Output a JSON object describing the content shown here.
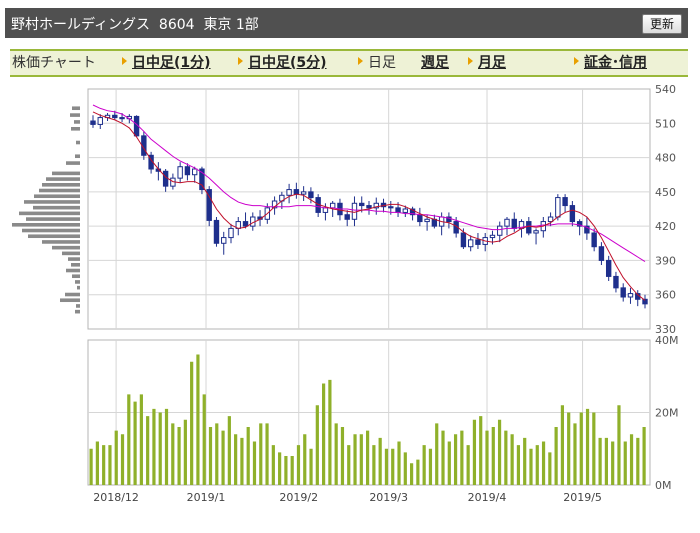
{
  "header": {
    "title": "野村ホールディングス  8604  東京 1部",
    "refresh_label": "更新"
  },
  "tabs": [
    {
      "label": "株価チャート",
      "link": false,
      "arrow": false
    },
    {
      "label": "日中足(1分)",
      "link": true,
      "arrow": true
    },
    {
      "label": "日中足(5分)",
      "link": true,
      "arrow": true
    },
    {
      "label": "日足",
      "link": false,
      "arrow": true
    },
    {
      "label": "週足",
      "link": true,
      "arrow": false
    },
    {
      "label": "月足",
      "link": true,
      "arrow": true
    },
    {
      "label": "証金･信用",
      "link": true,
      "arrow": true
    }
  ],
  "colors": {
    "candle": "#1e2f8c",
    "ma_short": "#c0102a",
    "ma_long": "#cc00cc",
    "volume": "#8fb02a",
    "profile": "#8a8a8a",
    "grid": "#d6d6d6",
    "border": "#b4b4b4"
  },
  "chart_data": [
    {
      "type": "candlestick",
      "yticks": [
        540,
        510,
        480,
        450,
        420,
        390,
        360,
        330
      ],
      "ylim": [
        330,
        540
      ],
      "xticks": [
        "2018/12",
        "2019/1",
        "2019/2",
        "2019/3",
        "2019/4",
        "2019/5"
      ],
      "grid": true,
      "candles": [
        [
          512,
          517,
          506,
          509
        ],
        [
          509,
          518,
          505,
          515
        ],
        [
          515,
          519,
          512,
          517
        ],
        [
          517,
          521,
          513,
          515
        ],
        [
          515,
          519,
          511,
          514
        ],
        [
          514,
          518,
          510,
          516
        ],
        [
          516,
          517,
          498,
          499
        ],
        [
          499,
          503,
          478,
          482
        ],
        [
          482,
          485,
          466,
          470
        ],
        [
          470,
          476,
          460,
          468
        ],
        [
          468,
          470,
          450,
          455
        ],
        [
          455,
          466,
          452,
          462
        ],
        [
          462,
          476,
          458,
          472
        ],
        [
          472,
          475,
          460,
          465
        ],
        [
          465,
          472,
          458,
          470
        ],
        [
          470,
          472,
          448,
          452
        ],
        [
          452,
          455,
          420,
          425
        ],
        [
          425,
          428,
          402,
          405
        ],
        [
          405,
          415,
          395,
          410
        ],
        [
          410,
          422,
          405,
          418
        ],
        [
          418,
          428,
          412,
          424
        ],
        [
          424,
          432,
          418,
          420
        ],
        [
          420,
          432,
          416,
          428
        ],
        [
          428,
          434,
          420,
          426
        ],
        [
          426,
          440,
          422,
          436
        ],
        [
          436,
          446,
          430,
          442
        ],
        [
          442,
          450,
          435,
          447
        ],
        [
          447,
          457,
          440,
          452
        ],
        [
          452,
          458,
          444,
          448
        ],
        [
          448,
          455,
          442,
          450
        ],
        [
          450,
          454,
          440,
          445
        ],
        [
          445,
          448,
          428,
          432
        ],
        [
          432,
          440,
          425,
          436
        ],
        [
          436,
          442,
          428,
          440
        ],
        [
          440,
          444,
          425,
          430
        ],
        [
          430,
          434,
          420,
          426
        ],
        [
          426,
          446,
          420,
          440
        ],
        [
          440,
          446,
          432,
          438
        ],
        [
          438,
          442,
          430,
          436
        ],
        [
          436,
          445,
          430,
          440
        ],
        [
          440,
          444,
          432,
          437
        ],
        [
          437,
          442,
          430,
          436
        ],
        [
          436,
          441,
          428,
          432
        ],
        [
          432,
          438,
          428,
          435
        ],
        [
          435,
          437,
          425,
          430
        ],
        [
          430,
          436,
          420,
          424
        ],
        [
          424,
          430,
          416,
          426
        ],
        [
          426,
          430,
          418,
          420
        ],
        [
          420,
          432,
          412,
          428
        ],
        [
          428,
          432,
          418,
          424
        ],
        [
          424,
          428,
          410,
          414
        ],
        [
          414,
          418,
          400,
          402
        ],
        [
          402,
          412,
          398,
          408
        ],
        [
          408,
          414,
          400,
          404
        ],
        [
          404,
          414,
          398,
          410
        ],
        [
          410,
          416,
          404,
          412
        ],
        [
          412,
          424,
          406,
          420
        ],
        [
          420,
          428,
          412,
          426
        ],
        [
          426,
          432,
          415,
          418
        ],
        [
          418,
          426,
          410,
          424
        ],
        [
          424,
          428,
          412,
          414
        ],
        [
          414,
          418,
          404,
          416
        ],
        [
          416,
          428,
          410,
          424
        ],
        [
          424,
          432,
          420,
          428
        ],
        [
          428,
          448,
          425,
          445
        ],
        [
          445,
          448,
          432,
          438
        ],
        [
          438,
          442,
          420,
          424
        ],
        [
          424,
          426,
          412,
          420
        ],
        [
          420,
          428,
          408,
          414
        ],
        [
          414,
          418,
          398,
          402
        ],
        [
          402,
          406,
          386,
          390
        ],
        [
          390,
          394,
          372,
          376
        ],
        [
          376,
          380,
          362,
          366
        ],
        [
          366,
          370,
          354,
          358
        ],
        [
          358,
          366,
          352,
          361
        ],
        [
          361,
          364,
          350,
          356
        ],
        [
          356,
          360,
          348,
          352
        ]
      ],
      "ma_short": [
        520,
        517,
        515,
        513,
        510,
        506,
        498,
        488,
        478,
        470,
        463,
        459,
        458,
        459,
        459,
        456,
        446,
        435,
        427,
        421,
        418,
        419,
        423,
        426,
        431,
        437,
        442,
        446,
        448,
        447,
        443,
        439,
        437,
        435,
        434,
        433,
        432,
        434,
        435,
        437,
        438,
        439,
        439,
        437,
        434,
        431,
        428,
        426,
        424,
        423,
        420,
        415,
        411,
        409,
        407,
        406,
        407,
        411,
        414,
        418,
        420,
        419,
        420,
        423,
        428,
        432,
        434,
        432,
        428,
        420,
        410,
        398,
        386,
        375,
        367,
        360,
        355
      ],
      "ma_long": [
        526,
        523,
        521,
        520,
        518,
        514,
        509,
        503,
        496,
        491,
        486,
        481,
        477,
        474,
        471,
        467,
        462,
        456,
        450,
        445,
        441,
        439,
        438,
        438,
        437,
        437,
        437,
        437,
        438,
        438,
        438,
        437,
        436,
        436,
        435,
        435,
        434,
        434,
        434,
        433,
        433,
        432,
        432,
        431,
        431,
        430,
        430,
        429,
        428,
        427,
        425,
        423,
        421,
        419,
        418,
        417,
        417,
        418,
        418,
        419,
        420,
        420,
        421,
        421,
        422,
        422,
        422,
        421,
        419,
        416,
        413,
        409,
        405,
        401,
        397,
        393,
        389
      ],
      "price_profile": [
        {
          "price": 523,
          "w": 8
        },
        {
          "price": 517,
          "w": 10
        },
        {
          "price": 511,
          "w": 6
        },
        {
          "price": 505,
          "w": 9
        },
        {
          "price": 493,
          "w": 4
        },
        {
          "price": 481,
          "w": 5
        },
        {
          "price": 475,
          "w": 14
        },
        {
          "price": 466,
          "w": 28
        },
        {
          "price": 461,
          "w": 34
        },
        {
          "price": 456,
          "w": 38
        },
        {
          "price": 451,
          "w": 41
        },
        {
          "price": 446,
          "w": 46
        },
        {
          "price": 441,
          "w": 56
        },
        {
          "price": 436,
          "w": 47
        },
        {
          "price": 431,
          "w": 61
        },
        {
          "price": 426,
          "w": 54
        },
        {
          "price": 421,
          "w": 68
        },
        {
          "price": 416,
          "w": 58
        },
        {
          "price": 411,
          "w": 52
        },
        {
          "price": 406,
          "w": 38
        },
        {
          "price": 401,
          "w": 28
        },
        {
          "price": 396,
          "w": 18
        },
        {
          "price": 391,
          "w": 12
        },
        {
          "price": 386,
          "w": 9
        },
        {
          "price": 381,
          "w": 14
        },
        {
          "price": 376,
          "w": 8
        },
        {
          "price": 371,
          "w": 5
        },
        {
          "price": 366,
          "w": 3
        },
        {
          "price": 360,
          "w": 15
        },
        {
          "price": 355,
          "w": 20
        },
        {
          "price": 350,
          "w": 4
        },
        {
          "price": 345,
          "w": 5
        }
      ]
    },
    {
      "type": "bar",
      "yticks": [
        "40M",
        "20M",
        "0M"
      ],
      "ylim": [
        0,
        40
      ],
      "values": [
        10,
        12,
        11,
        11,
        15,
        14,
        25,
        23,
        25,
        19,
        21,
        20,
        21,
        17,
        16,
        18,
        34,
        36,
        25,
        16,
        17,
        15,
        19,
        14,
        13,
        16,
        12,
        17,
        17,
        11,
        9,
        8,
        8,
        11,
        14,
        10,
        22,
        28,
        29,
        17,
        16,
        11,
        14,
        14,
        15,
        11,
        13,
        10,
        10,
        12,
        9,
        6,
        7,
        11,
        10,
        17,
        15,
        12,
        14,
        15,
        11,
        18,
        19,
        15,
        16,
        18,
        15,
        14,
        11,
        13,
        10,
        11,
        12,
        9,
        16,
        22,
        20,
        17,
        20,
        21,
        20,
        13,
        13,
        12,
        22,
        12,
        14,
        13,
        16
      ]
    }
  ]
}
